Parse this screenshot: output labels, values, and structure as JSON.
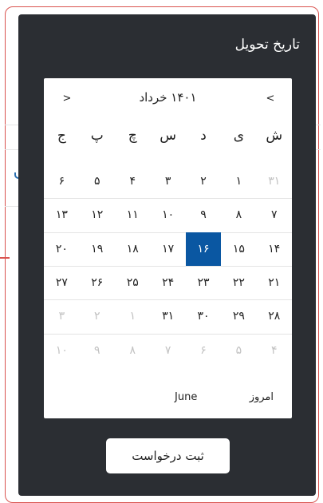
{
  "dialog": {
    "title": "تاریخ تحویل",
    "submit_label": "ثبت درخواست"
  },
  "calendar": {
    "month_title": "۱۴۰۱ خرداد",
    "prev_label": "<",
    "next_label": ">",
    "weekdays": [
      "ش",
      "ی",
      "د",
      "س",
      "چ",
      "پ",
      "ج"
    ],
    "weeks": [
      [
        {
          "t": "۳۱",
          "m": true
        },
        {
          "t": "۱"
        },
        {
          "t": "۲"
        },
        {
          "t": "۳"
        },
        {
          "t": "۴"
        },
        {
          "t": "۵"
        },
        {
          "t": "۶"
        }
      ],
      [
        {
          "t": "۷"
        },
        {
          "t": "۸"
        },
        {
          "t": "۹"
        },
        {
          "t": "۱۰"
        },
        {
          "t": "۱۱"
        },
        {
          "t": "۱۲"
        },
        {
          "t": "۱۳"
        }
      ],
      [
        {
          "t": "۱۴"
        },
        {
          "t": "۱۵"
        },
        {
          "t": "۱۶",
          "s": true
        },
        {
          "t": "۱۷"
        },
        {
          "t": "۱۸"
        },
        {
          "t": "۱۹"
        },
        {
          "t": "۲۰"
        }
      ],
      [
        {
          "t": "۲۱"
        },
        {
          "t": "۲۲"
        },
        {
          "t": "۲۳"
        },
        {
          "t": "۲۴"
        },
        {
          "t": "۲۵"
        },
        {
          "t": "۲۶"
        },
        {
          "t": "۲۷"
        }
      ],
      [
        {
          "t": "۲۸"
        },
        {
          "t": "۲۹"
        },
        {
          "t": "۳۰"
        },
        {
          "t": "۳۱"
        },
        {
          "t": "۱",
          "m": true
        },
        {
          "t": "۲",
          "m": true
        },
        {
          "t": "۳",
          "m": true
        }
      ],
      [
        {
          "t": "۴",
          "m": true
        },
        {
          "t": "۵",
          "m": true
        },
        {
          "t": "۶",
          "m": true
        },
        {
          "t": "۷",
          "m": true
        },
        {
          "t": "۸",
          "m": true
        },
        {
          "t": "۹",
          "m": true
        },
        {
          "t": "۱۰",
          "m": true
        }
      ]
    ],
    "today_label": "امروز",
    "month_label": "June"
  },
  "colors": {
    "dialog_bg": "#2b2e33",
    "selected_bg": "#0a57a2",
    "frame_accent": "#d9534f"
  }
}
